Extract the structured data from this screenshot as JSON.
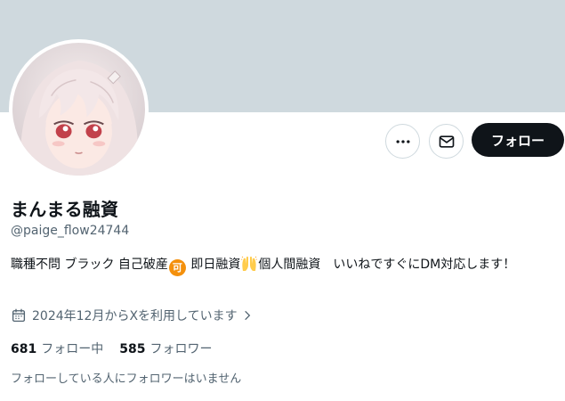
{
  "profile": {
    "banner_color": "#cfd9de",
    "display_name": "まんまる融資",
    "handle": "@paige_flow24744",
    "bio": {
      "part1": "職種不問 ブラック 自己破産",
      "emoji_ok": "可",
      "part2": " 即日融資",
      "part3": "個人間融資　いいねですぐにDM対応します！"
    },
    "joined": "2024年12月からXを利用しています",
    "following": {
      "count": "681",
      "label": "フォロー中"
    },
    "followers": {
      "count": "585",
      "label": "フォロワー"
    },
    "followers_you_know": "フォローしている人にフォロワーはいません"
  },
  "actions": {
    "more_icon": "more-horizontal-icon",
    "dm_icon": "envelope-icon",
    "follow_label": "フォロー"
  },
  "colors": {
    "text_primary": "#0f1419",
    "text_secondary": "#536471",
    "border": "#cfd9de",
    "follow_bg": "#0f1419"
  }
}
